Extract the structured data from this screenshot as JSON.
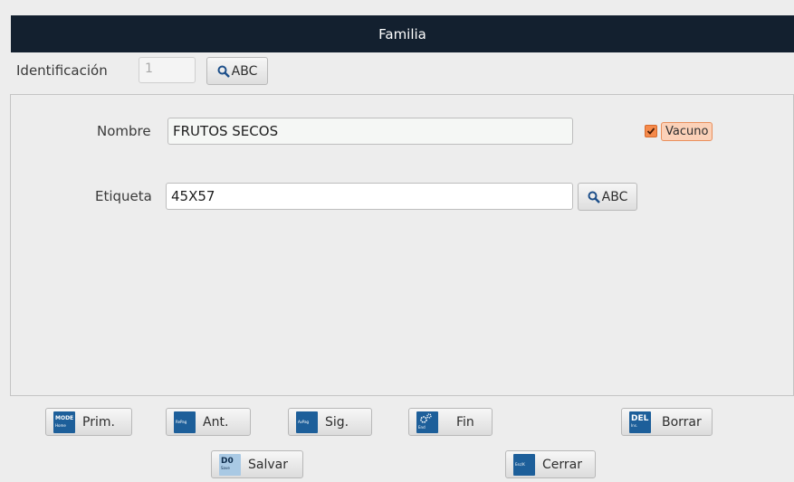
{
  "window": {
    "title": "Familia"
  },
  "identification": {
    "label": "Identificación",
    "value": "1",
    "search_label": "ABC"
  },
  "form": {
    "nombre_label": "Nombre",
    "nombre_value": "FRUTOS SECOS",
    "etiqueta_label": "Etiqueta",
    "etiqueta_value": "45X57",
    "etiqueta_search_label": "ABC",
    "vacuno_label": "Vacuno",
    "vacuno_checked": true
  },
  "buttons": {
    "prim": {
      "label": "Prim.",
      "key": "MODE",
      "key_sub": "Home"
    },
    "ant": {
      "label": "Ant.",
      "key": "RePag"
    },
    "sig": {
      "label": "Sig.",
      "key": "AvPag"
    },
    "fin": {
      "label": "Fin",
      "key_sub": "End"
    },
    "borrar": {
      "label": "Borrar",
      "key": "DEL",
      "key_sub": "Ins."
    },
    "salvar": {
      "label": "Salvar",
      "key": "D0",
      "key_sub": "Save"
    },
    "cerrar": {
      "label": "Cerrar",
      "key": "Esc/K"
    }
  },
  "colors": {
    "titlebar": "#13202f",
    "accent_orange": "#f58a4b",
    "key_icon_blue": "#1d5f9a"
  }
}
